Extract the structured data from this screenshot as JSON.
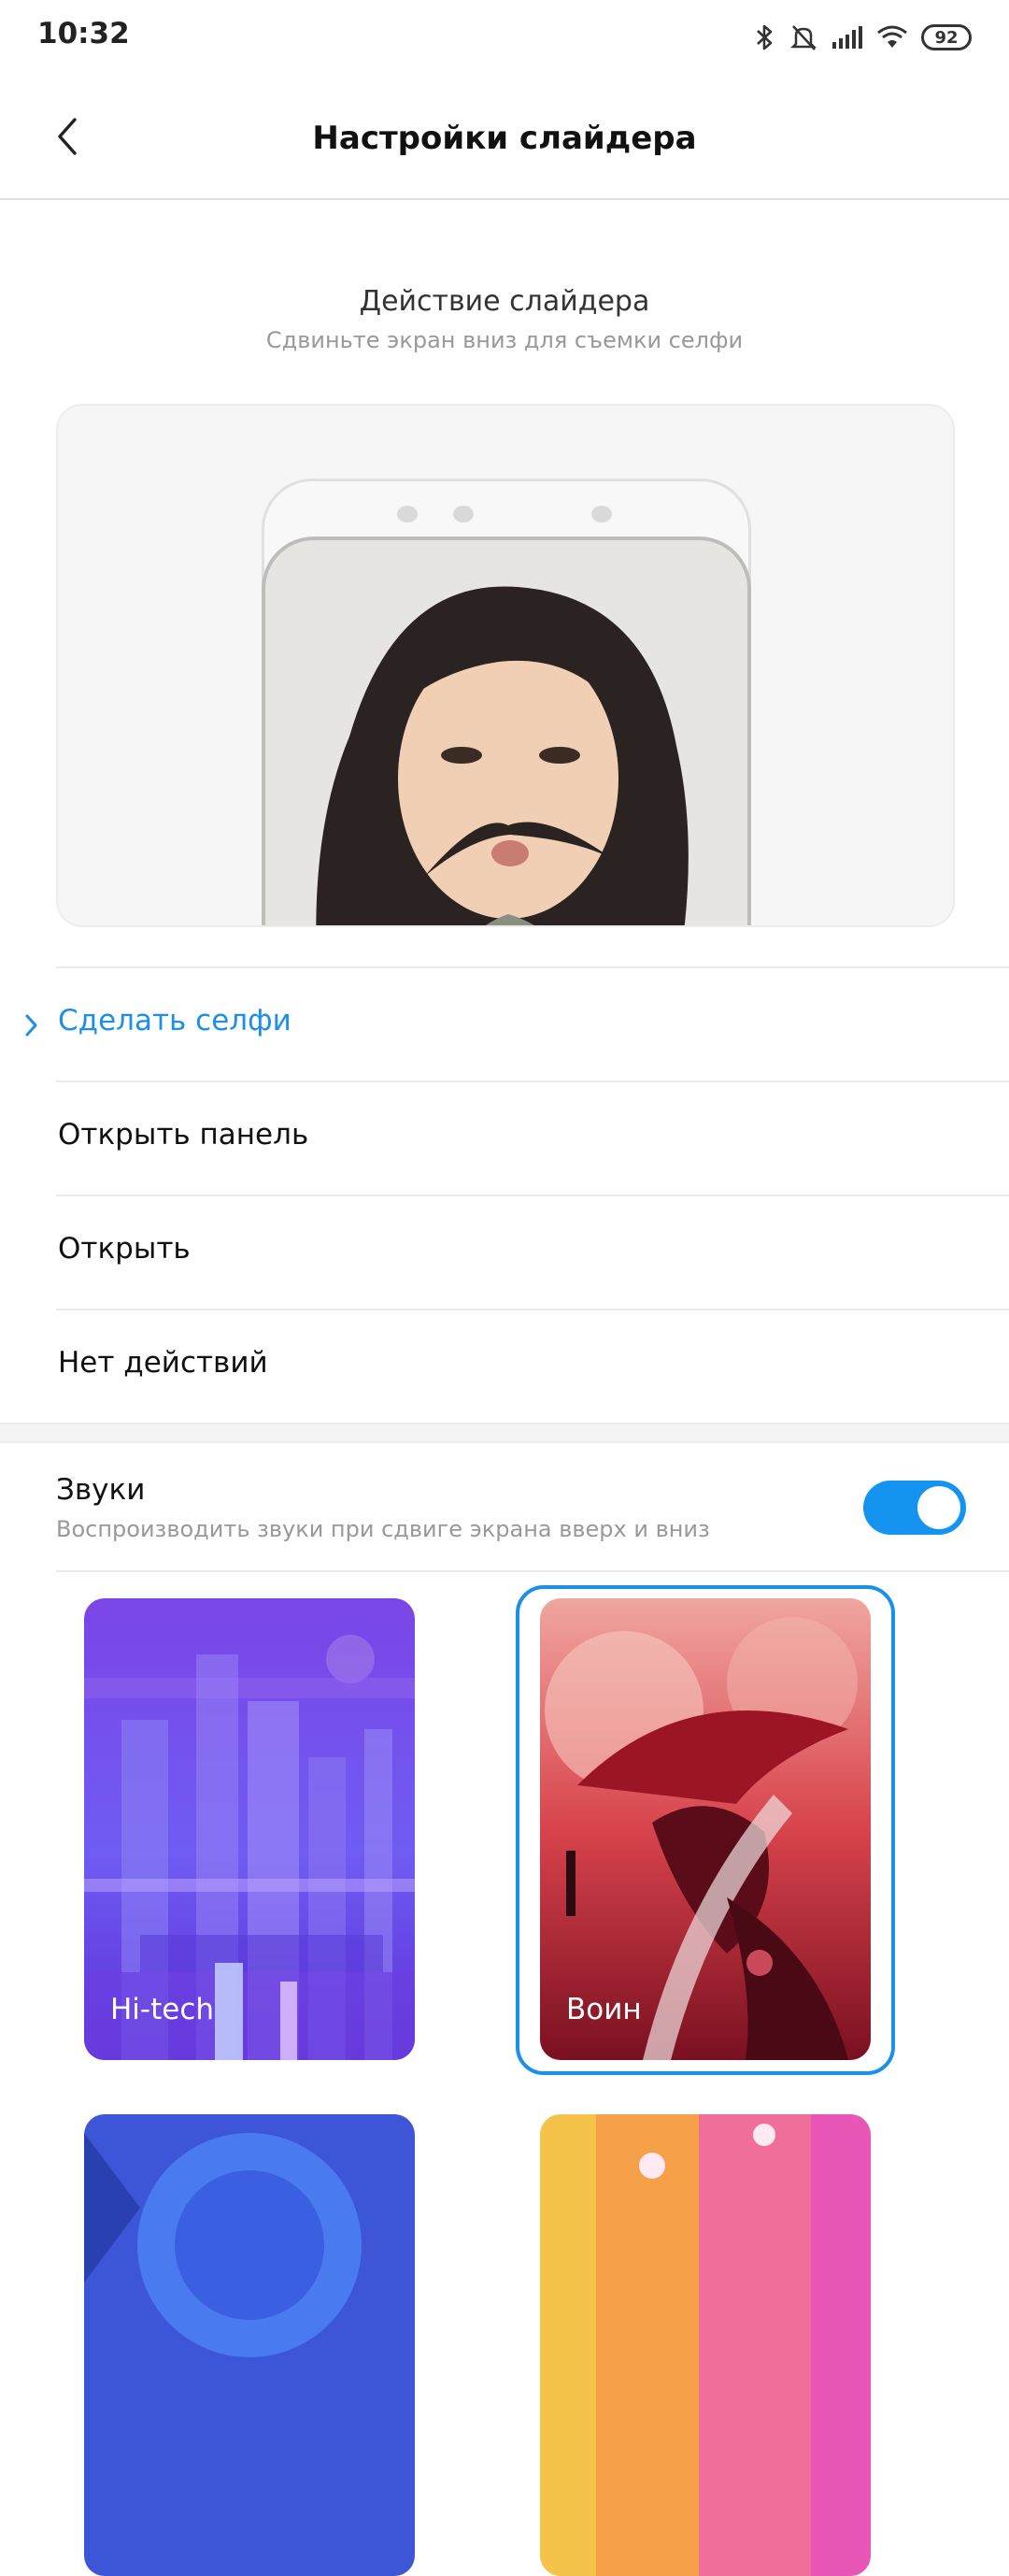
{
  "status_bar": {
    "time": "10:32",
    "battery": "92"
  },
  "header": {
    "title": "Настройки слайдера"
  },
  "section": {
    "title": "Действие слайдера",
    "subtitle": "Сдвиньте экран вниз для съемки селфи"
  },
  "options": [
    {
      "label": "Сделать селфи",
      "selected": true
    },
    {
      "label": "Открыть панель",
      "selected": false
    },
    {
      "label": "Открыть",
      "selected": false
    },
    {
      "label": "Нет действий",
      "selected": false
    }
  ],
  "sounds": {
    "title": "Звуки",
    "subtitle": "Воспроизводить звуки при сдвиге экрана вверх и вниз",
    "enabled": true
  },
  "themes": [
    {
      "label": "Hi-tech",
      "selected": false
    },
    {
      "label": "Воин",
      "selected": true
    }
  ],
  "colors": {
    "accent": "#1a90e8",
    "toggle": "#1593f0"
  }
}
